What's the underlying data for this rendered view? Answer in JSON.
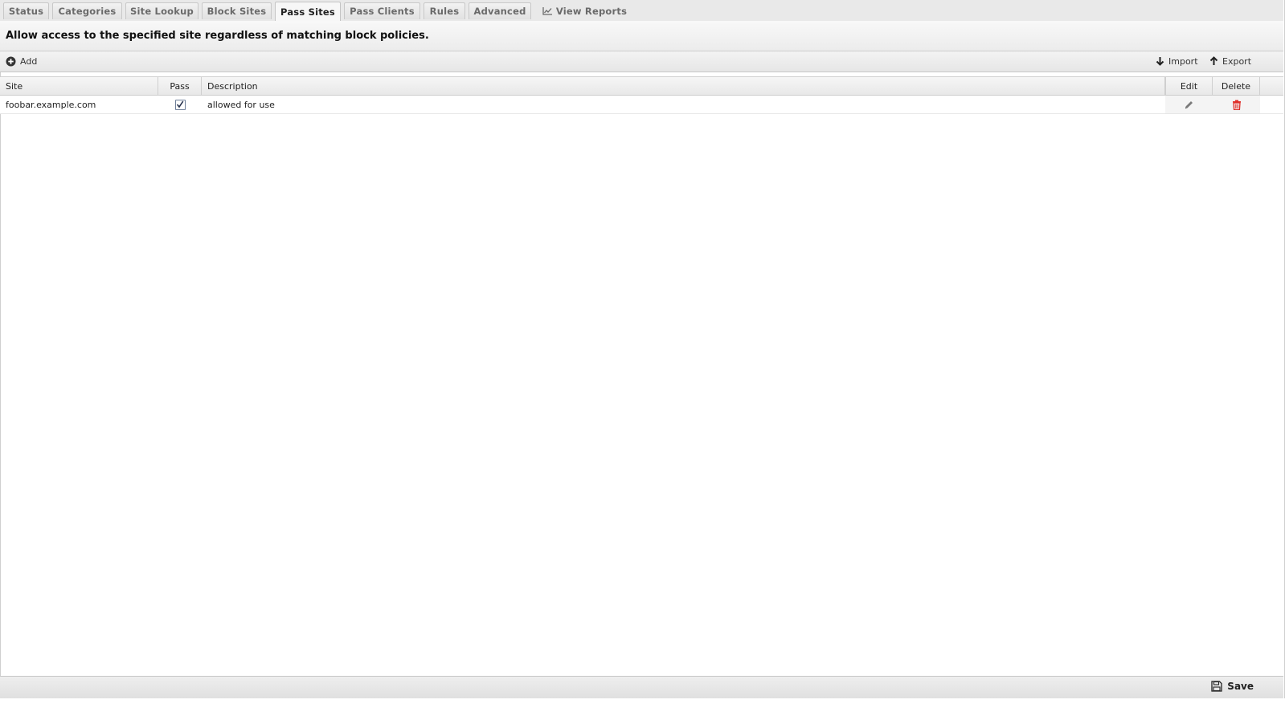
{
  "tabs": [
    {
      "label": "Status"
    },
    {
      "label": "Categories"
    },
    {
      "label": "Site Lookup"
    },
    {
      "label": "Block Sites"
    },
    {
      "label": "Pass Sites",
      "active": true
    },
    {
      "label": "Pass Clients"
    },
    {
      "label": "Rules"
    },
    {
      "label": "Advanced"
    },
    {
      "label": "View Reports",
      "icon": "line-chart-icon"
    }
  ],
  "description": "Allow access to the specified site regardless of matching block policies.",
  "toolbar": {
    "add_label": "Add",
    "import_label": "Import",
    "export_label": "Export"
  },
  "grid": {
    "columns": [
      "Site",
      "Pass",
      "Description",
      "Edit",
      "Delete"
    ],
    "rows": [
      {
        "site": "foobar.example.com",
        "pass": true,
        "description": "allowed for use"
      }
    ]
  },
  "footer": {
    "save_label": "Save"
  },
  "colors": {
    "delete_icon": "#e0302a",
    "checkbox_border": "#6f7f99"
  }
}
